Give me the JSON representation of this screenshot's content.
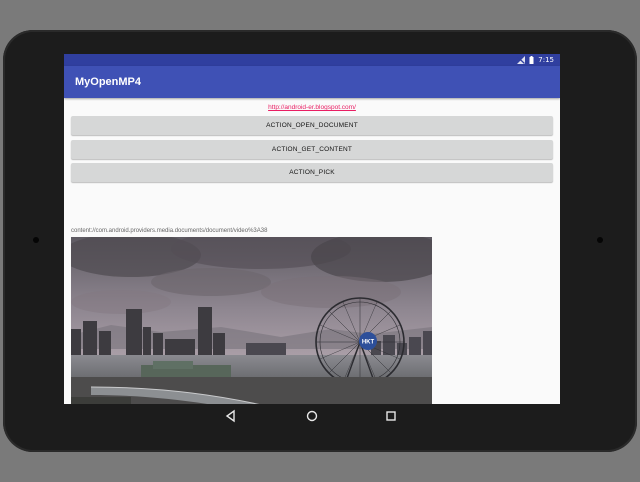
{
  "status_bar": {
    "time": "7:15",
    "icons": [
      "signal-off-icon",
      "battery-icon"
    ]
  },
  "app_bar": {
    "title": "MyOpenMP4"
  },
  "content": {
    "link_text": "http://android-er.blogspot.com/",
    "buttons": [
      {
        "label": "ACTION_OPEN_DOCUMENT"
      },
      {
        "label": "ACTION_GET_CONTENT"
      },
      {
        "label": "ACTION_PICK"
      }
    ],
    "uri_text": "content://com.android.providers.media.documents/document/video%3A38",
    "video_badge_text": "HKT"
  },
  "nav_bar": {
    "icons": [
      "back-icon",
      "home-icon",
      "recents-icon"
    ]
  },
  "colors": {
    "primary": "#3f51b5",
    "primary_dark": "#303f9f",
    "accent": "#e91e63",
    "button": "#d6d7d7"
  }
}
